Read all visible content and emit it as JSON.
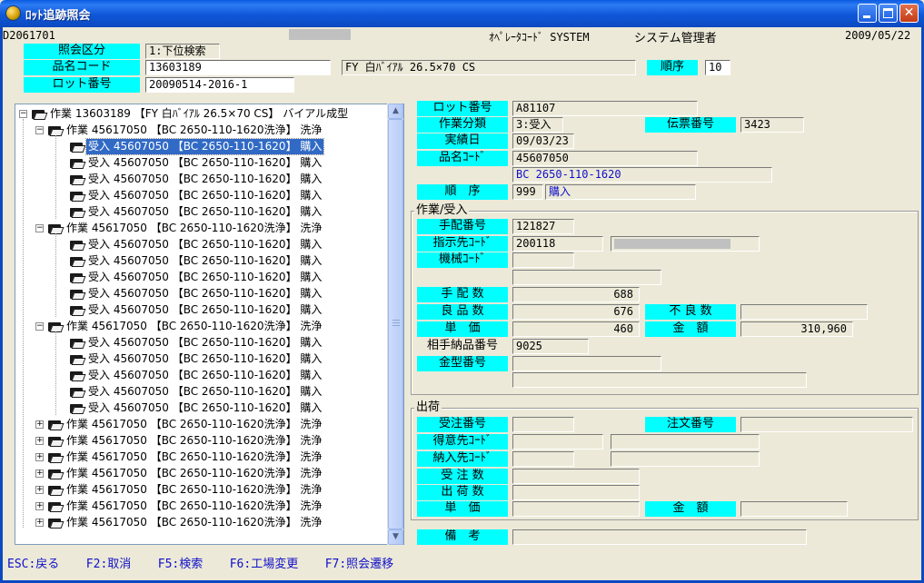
{
  "window": {
    "title": "ﾛｯﾄ追跡照会",
    "icon": "app-globe-icon"
  },
  "header": {
    "screen_id": "D2061701",
    "operator_label": "ｵﾍﾟﾚｰﾀｺｰﾄﾞ SYSTEM",
    "operator_name": "システム管理者",
    "date": "2009/05/22"
  },
  "search": {
    "mode_label": "照会区分",
    "mode_value": "1:下位検索",
    "item_code_label": "品名コード",
    "item_code_value": "13603189",
    "item_name_value": "FY  白ﾊﾞｲｱﾙ 26.5×70  CS",
    "order_label": "順序",
    "order_value": "10",
    "lot_label": "ロット番号",
    "lot_value": "20090514-2016-1"
  },
  "tree": {
    "root": "作業 13603189 【FY  白ﾊﾞｲｱﾙ 26.5×70  CS】 バイアル成型",
    "nodes": [
      {
        "level": 1,
        "expander": "-",
        "text": "作業 45617050  【BC    2650-110-1620洗浄】  洗浄"
      },
      {
        "level": 2,
        "expander": "",
        "text": "受入 45607050  【BC    2650-110-1620】 購入",
        "selected": true
      },
      {
        "level": 2,
        "expander": "",
        "text": "受入 45607050  【BC    2650-110-1620】 購入"
      },
      {
        "level": 2,
        "expander": "",
        "text": "受入 45607050  【BC    2650-110-1620】 購入"
      },
      {
        "level": 2,
        "expander": "",
        "text": "受入 45607050  【BC    2650-110-1620】 購入"
      },
      {
        "level": 2,
        "expander": "",
        "text": "受入 45607050  【BC    2650-110-1620】 購入"
      },
      {
        "level": 1,
        "expander": "-",
        "text": "作業 45617050  【BC    2650-110-1620洗浄】  洗浄"
      },
      {
        "level": 2,
        "expander": "",
        "text": "受入 45607050  【BC    2650-110-1620】 購入"
      },
      {
        "level": 2,
        "expander": "",
        "text": "受入 45607050  【BC    2650-110-1620】 購入"
      },
      {
        "level": 2,
        "expander": "",
        "text": "受入 45607050  【BC    2650-110-1620】 購入"
      },
      {
        "level": 2,
        "expander": "",
        "text": "受入 45607050  【BC    2650-110-1620】 購入"
      },
      {
        "level": 2,
        "expander": "",
        "text": "受入 45607050  【BC    2650-110-1620】 購入"
      },
      {
        "level": 1,
        "expander": "-",
        "text": "作業 45617050  【BC    2650-110-1620洗浄】  洗浄"
      },
      {
        "level": 2,
        "expander": "",
        "text": "受入 45607050  【BC    2650-110-1620】 購入"
      },
      {
        "level": 2,
        "expander": "",
        "text": "受入 45607050  【BC    2650-110-1620】 購入"
      },
      {
        "level": 2,
        "expander": "",
        "text": "受入 45607050  【BC    2650-110-1620】 購入"
      },
      {
        "level": 2,
        "expander": "",
        "text": "受入 45607050  【BC    2650-110-1620】 購入"
      },
      {
        "level": 2,
        "expander": "",
        "text": "受入 45607050  【BC    2650-110-1620】 購入"
      },
      {
        "level": 1,
        "expander": "+",
        "text": "作業 45617050  【BC    2650-110-1620洗浄】  洗浄"
      },
      {
        "level": 1,
        "expander": "+",
        "text": "作業 45617050  【BC    2650-110-1620洗浄】  洗浄"
      },
      {
        "level": 1,
        "expander": "+",
        "text": "作業 45617050  【BC    2650-110-1620洗浄】  洗浄"
      },
      {
        "level": 1,
        "expander": "+",
        "text": "作業 45617050  【BC    2650-110-1620洗浄】  洗浄"
      },
      {
        "level": 1,
        "expander": "+",
        "text": "作業 45617050  【BC    2650-110-1620洗浄】  洗浄"
      },
      {
        "level": 1,
        "expander": "+",
        "text": "作業 45617050  【BC    2650-110-1620洗浄】  洗浄"
      },
      {
        "level": 1,
        "expander": "+",
        "text": "作業 45617050  【BC    2650-110-1620洗浄】  洗浄"
      }
    ]
  },
  "detail": {
    "lot_no_label": "ロット番号",
    "lot_no_value": "A81107",
    "work_type_label": "作業分類",
    "work_type_value": "3:受入",
    "slip_no_label": "伝票番号",
    "slip_no_value": "3423",
    "result_date_label": "実績日",
    "result_date_value": "09/03/23",
    "item_code_label": "品名ｺｰﾄﾞ",
    "item_code_value": "45607050",
    "item_name_value": "BC    2650-110-1620",
    "order_label": "順　序",
    "order_value": "999",
    "order_type_value": "購入"
  },
  "work_group": {
    "title": "作業/受入",
    "arrange_no_label": "手配番号",
    "arrange_no_value": "121827",
    "dest_code_label": "指示先ｺｰﾄﾞ",
    "dest_code_value": "200118",
    "machine_code_label": "機械ｺｰﾄﾞ",
    "machine_code_value": "",
    "arrange_qty_label": "手 配 数",
    "arrange_qty_value": "688",
    "good_qty_label": "良 品 数",
    "good_qty_value": "676",
    "defect_qty_label": "不 良 数",
    "defect_qty_value": "",
    "unit_price_label": "単　価",
    "unit_price_value": "460",
    "amount_label": "金　額",
    "amount_value": "310,960",
    "partner_delivery_label": "相手納品番号",
    "partner_delivery_value": "9025",
    "mold_no_label": "金型番号",
    "mold_no_value": ""
  },
  "ship_group": {
    "title": "出荷",
    "order_no_label": "受注番号",
    "order_no_value": "",
    "po_no_label": "注文番号",
    "po_no_value": "",
    "customer_code_label": "得意先ｺｰﾄﾞ",
    "customer_code_value": "",
    "delivery_code_label": "納入先ｺｰﾄﾞ",
    "delivery_code_value": "",
    "order_qty_label": "受 注 数",
    "order_qty_value": "",
    "ship_qty_label": "出 荷 数",
    "ship_qty_value": "",
    "unit_price_label": "単　価",
    "unit_price_value": "",
    "amount_label": "金　額",
    "amount_value": ""
  },
  "remarks": {
    "label": "備　考",
    "value": ""
  },
  "footer": {
    "esc": "ESC:戻る",
    "f2": "F2:取消",
    "f5": "F5:検索",
    "f6": "F6:工場変更",
    "f7": "F7:照会遷移"
  },
  "colors": {
    "label_bg": "#00ffff",
    "title_bar": "#0b49c0",
    "selection": "#316ac5",
    "footer_text": "#1010c8"
  }
}
